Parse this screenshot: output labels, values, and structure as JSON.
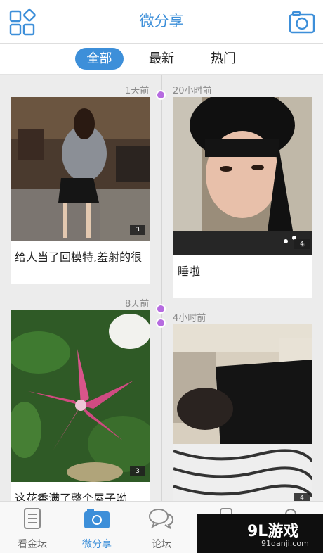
{
  "header": {
    "title": "微分享",
    "left_icon": "grid-apps-icon",
    "right_icon": "camera-icon",
    "accent_color": "#3d8fd9"
  },
  "segments": [
    {
      "label": "全部",
      "active": true
    },
    {
      "label": "最新",
      "active": false
    },
    {
      "label": "热门",
      "active": false
    }
  ],
  "feed": {
    "left": [
      {
        "time": "1天前",
        "caption": "给人当了回模特,羞射的很",
        "image_count": "3"
      },
      {
        "time": "8天前",
        "caption": "这花香满了整个屋子呦",
        "image_count": "3"
      }
    ],
    "right": [
      {
        "time": "20小时前",
        "caption": "睡啦",
        "image_count": "4"
      },
      {
        "time": "4小时前",
        "caption": "",
        "image_count": "4"
      }
    ],
    "dot_color": "#b66be0"
  },
  "tabbar": [
    {
      "label": "看金坛",
      "icon": "document-icon",
      "active": false
    },
    {
      "label": "微分享",
      "icon": "camera-icon",
      "active": true
    },
    {
      "label": "论坛",
      "icon": "chat-bubbles-icon",
      "active": false
    },
    {
      "label": "",
      "icon": "phone-icon",
      "active": false
    },
    {
      "label": "",
      "icon": "user-icon",
      "active": false
    }
  ],
  "watermark": {
    "logo": "9L游戏",
    "url": "91danji.com"
  }
}
